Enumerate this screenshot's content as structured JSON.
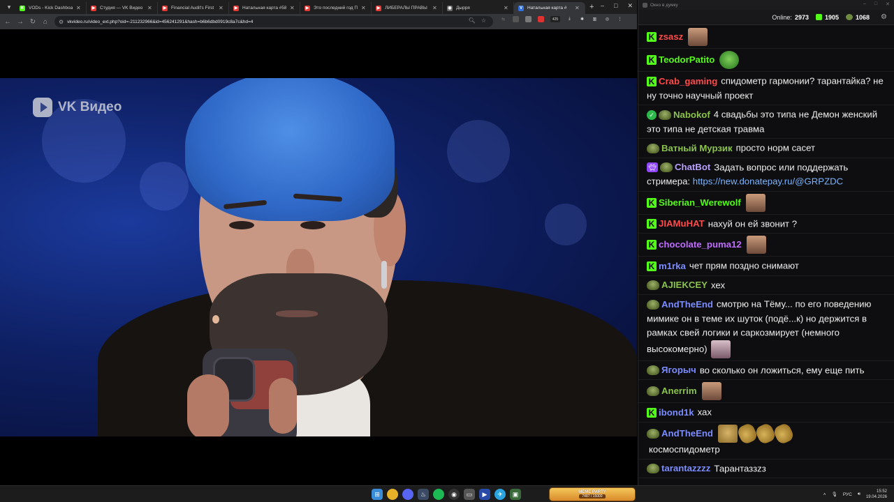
{
  "browser": {
    "tabs": [
      {
        "title": "VODs - Kick Dashboard",
        "favicon_color": "#53fc18",
        "favicon_glyph": "K"
      },
      {
        "title": "Студия — VK Видео Li",
        "favicon_color": "#e53935",
        "favicon_glyph": "▶"
      },
      {
        "title": "Financial Audit's First F",
        "favicon_color": "#e53935",
        "favicon_glyph": "▶"
      },
      {
        "title": "Натальная карта #58 Ä",
        "favicon_color": "#e53935",
        "favicon_glyph": "▶"
      },
      {
        "title": "Это последний год Пу",
        "favicon_color": "#e53935",
        "favicon_glyph": "▶"
      },
      {
        "title": "ЛИБЕРАЛЫ ПРАВЫ ВС",
        "favicon_color": "#e53935",
        "favicon_glyph": "▶"
      },
      {
        "title": "Дырря",
        "favicon_color": "#6a6a6a",
        "favicon_glyph": "◉"
      },
      {
        "title": "Натальная карта #",
        "favicon_color": "#2f6fe0",
        "favicon_glyph": "V",
        "active": true
      }
    ],
    "new_tab": "+",
    "window_controls": [
      "–",
      "□",
      "✕"
    ],
    "url": "vkvideo.ru/video_ext.php?oid=-211232966&id=456241291&hash=b6b6dbd0919c8a7c&hd=4",
    "extension_badge": "425"
  },
  "video": {
    "watermark": "VK Видео"
  },
  "chat": {
    "window_title": "Окно в думку",
    "online_label": "Online:",
    "online_count": "2973",
    "stat1": "1905",
    "stat2": "1068",
    "colors": {
      "kick_green": "#53fc18",
      "bg": "#0e0e10"
    },
    "messages": [
      {
        "badges": [
          "kick"
        ],
        "user": "zsasz",
        "color": "#ff4a4a",
        "text": "",
        "emotes": [
          "face"
        ]
      },
      {
        "badges": [
          "kick"
        ],
        "user": "TeodorPatito",
        "color": "#53fc18",
        "text": "",
        "emotes": [
          "pepe"
        ]
      },
      {
        "badges": [
          "kick"
        ],
        "user": "Crab_gaming",
        "color": "#ff4a4a",
        "text": "спидометр гармонии? тарантайка? не ну точно научный проект",
        "emotes": []
      },
      {
        "badges": [
          "verified",
          "pepe"
        ],
        "user": "Nabokof",
        "color": "#8bc34a",
        "text": "4 свадьбы это типа не Демон женский это типа не детская травма",
        "emotes": []
      },
      {
        "badges": [
          "pepe"
        ],
        "user": "Ватный Мурзик",
        "color": "#8bc34a",
        "text": "просто норм сасет",
        "emotes": []
      },
      {
        "badges": [
          "bot",
          "pepe"
        ],
        "user": "ChatBot",
        "color": "#b9a0ff",
        "text": "Задать вопрос или поддержать стримера:",
        "link": "https://new.donatepay.ru/@GRPZDC",
        "emotes": []
      },
      {
        "badges": [
          "kick"
        ],
        "user": "Siberian_Werewolf",
        "color": "#53fc18",
        "text": "",
        "emotes": [
          "face"
        ]
      },
      {
        "badges": [
          "kick"
        ],
        "user": "JIAMuHAT",
        "color": "#ff4a4a",
        "text": "нахуй он ей звонит ?",
        "emotes": []
      },
      {
        "badges": [
          "kick"
        ],
        "user": "chocolate_puma12",
        "color": "#c06cff",
        "text": "",
        "emotes": [
          "face"
        ]
      },
      {
        "badges": [
          "kick"
        ],
        "user": "m1rka",
        "color": "#7b8cff",
        "text": "чет прям поздно снимают",
        "emotes": []
      },
      {
        "badges": [
          "pepe"
        ],
        "user": "AJIEKCEY",
        "color": "#8bc34a",
        "text": "хех",
        "emotes": []
      },
      {
        "badges": [
          "pepe"
        ],
        "user": "AndTheEnd",
        "color": "#7b8cff",
        "text": "смотрю на Тёму... по его поведению мимике он в теме их шуток (подё...к) но держится в рамках свей логики и саркозмирует (немного высокомерно)",
        "emotes": [
          "pale"
        ]
      },
      {
        "badges": [
          "pepe"
        ],
        "user": "Ягорыч",
        "color": "#7b8cff",
        "text": "во сколько он ложиться, ему еще пить",
        "emotes": []
      },
      {
        "badges": [
          "pepe"
        ],
        "user": "Anerrim",
        "color": "#8bc34a",
        "text": "",
        "emotes": [
          "face"
        ]
      },
      {
        "badges": [
          "kick"
        ],
        "user": "ibond1k",
        "color": "#7b8cff",
        "text": "хах",
        "emotes": []
      },
      {
        "badges": [
          "pepe"
        ],
        "user": "AndTheEnd",
        "color": "#7b8cff",
        "text": "",
        "emotes": [
          "doge",
          "lizard",
          "lizard",
          "lizard"
        ],
        "after": "космоспидометр"
      },
      {
        "badges": [
          "pepe"
        ],
        "user": "tarantazzzz",
        "color": "#7b8cff",
        "text": "Тарантаззzз",
        "emotes": []
      }
    ]
  },
  "taskbar": {
    "banner_title": "MEME PARTY",
    "banner_progress": "7487 / 15000",
    "lang": "РУС",
    "time": "15:52",
    "date": "19.04.2026"
  }
}
